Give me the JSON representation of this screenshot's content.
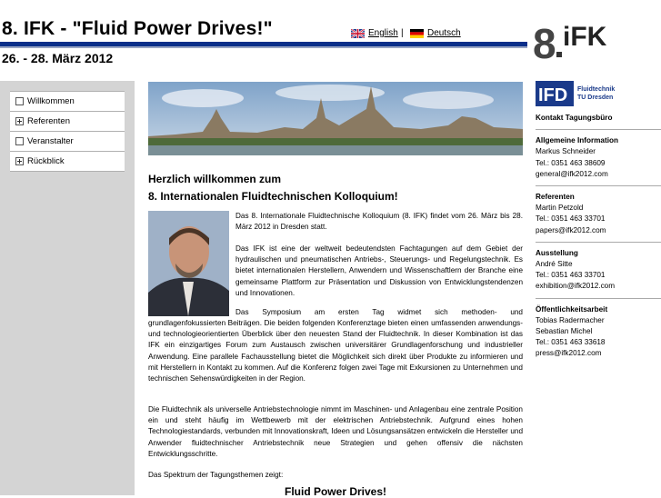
{
  "header": {
    "title": "8. IFK - \"Fluid Power Drives!\"",
    "date": "26. - 28. März 2012",
    "logo_text": "8.IFK"
  },
  "languages": {
    "english": "English",
    "separator": "|",
    "deutsch": "Deutsch"
  },
  "nav": {
    "items": [
      {
        "label": "Willkommen",
        "icon": "square-icon"
      },
      {
        "label": "Referenten",
        "icon": "expand-plus-icon"
      },
      {
        "label": "Veranstalter",
        "icon": "square-icon"
      },
      {
        "label": "Rückblick",
        "icon": "expand-plus-icon"
      }
    ]
  },
  "main": {
    "welcome_line1": "Herzlich willkommen zum",
    "welcome_line2": "8. Internationalen Fluidtechnischen Kolloquium!",
    "p1": "Das 8. Internationale Fluidtechnische Kolloquium (8. IFK) findet vom 26. März bis 28. März 2012 in Dresden statt.",
    "p2": "Das IFK ist eine der weltweit bedeutendsten Fachtagungen auf dem Gebiet der hydraulischen und pneumatischen Antriebs-, Steuerungs- und Regelungstechnik. Es bietet internationalen Herstellern, Anwendern und Wissenschaftlern der Branche eine gemeinsame Plattform zur Präsentation und Diskussion von Entwicklungstendenzen und Innovationen.",
    "p3a": "Das Symposium am ersten Tag widmet sich methoden- und",
    "p3b": "grundlagenfokussierten Beiträgen. Die beiden folgenden Konferenztage bieten einen umfassenden anwendungs- und technologieorientierten Überblick über den neuesten Stand der Fluidtechnik. In dieser Kombination ist das IFK ein einzigartiges Forum zum Austausch zwischen universitärer Grundlagenforschung und industrieller Anwendung. Eine parallele Fachausstellung bietet die Möglichkeit sich direkt über Produkte zu informieren und mit Herstellern in Kontakt zu kommen. Auf die Konferenz folgen zwei Tage mit Exkursionen zu Unternehmen und technischen Sehenswürdigkeiten in der Region.",
    "p4": "Die Fluidtechnik als universelle Antriebstechnologie nimmt im Maschinen- und Anlagenbau eine zentrale Position ein und steht häufig im Wettbewerb mit der elektrischen Antriebstechnik. Aufgrund eines hohen Technologiestandards, verbunden mit Innovationskraft, Ideen und Lösungsansätzen entwickeln die Hersteller und Anwender fluidtechnischer Antriebstechnik neue Strategien und gehen offensiv die nächsten Entwicklungsschritte.",
    "p5": "Das Spektrum der Tagungsthemen zeigt:",
    "bottom_heading": "Fluid Power Drives!"
  },
  "right": {
    "ifd_logo_text": "IFD",
    "ifd_line1": "Fluidtechnik",
    "ifd_line2": "TU Dresden",
    "contact_title": "Kontakt Tagungsbüro",
    "sections": [
      {
        "heading": "Allgemeine Information",
        "lines": [
          "Markus Schneider",
          "Tel.: 0351 463 38609",
          "general@ifk2012.com"
        ]
      },
      {
        "heading": "Referenten",
        "lines": [
          "Martin Petzold",
          "Tel.: 0351 463 33701",
          "papers@ifk2012.com"
        ]
      },
      {
        "heading": "Ausstellung",
        "lines": [
          "André Sitte",
          "Tel.: 0351 463 33701",
          "exhibition@ifk2012.com"
        ]
      },
      {
        "heading": "Öffentlichkeitsarbeit",
        "lines": [
          "Tobias Radermacher",
          "Sebastian Michel",
          "Tel.: 0351 463 33618",
          "press@ifk2012.com"
        ]
      }
    ]
  },
  "colors": {
    "header_bar": "#0b2f8a",
    "sidebar_bg": "#d4d4d4",
    "ifd_blue": "#1a3a8a"
  }
}
